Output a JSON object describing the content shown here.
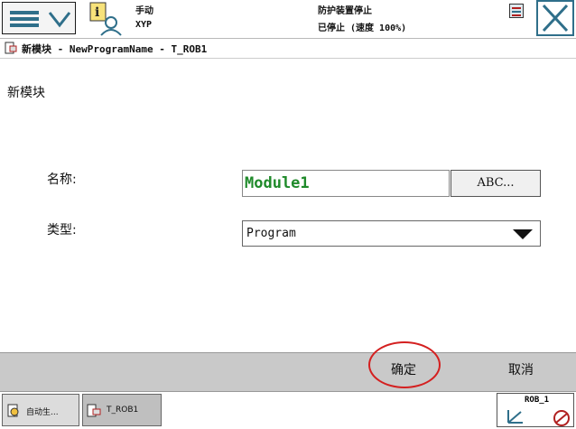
{
  "header": {
    "mode": "手动",
    "system": "XYP",
    "safety_state": "防护装置停止",
    "run_state": "已停止 (速度 100%)"
  },
  "titlebar": {
    "text": "新模块 - NewProgramName - T_ROB1"
  },
  "form": {
    "heading": "新模块",
    "name_label": "名称:",
    "name_value": "Module1",
    "abc_button": "ABC...",
    "type_label": "类型:",
    "type_value": "Program"
  },
  "actions": {
    "ok": "确定",
    "cancel": "取消"
  },
  "taskbar": {
    "task1": "自动生...",
    "task2": "T_ROB1",
    "robot": "ROB_1"
  },
  "colors": {
    "accent": "#2f6f8a",
    "name_text": "#1f8a2a",
    "highlight_circle": "#d42020"
  }
}
